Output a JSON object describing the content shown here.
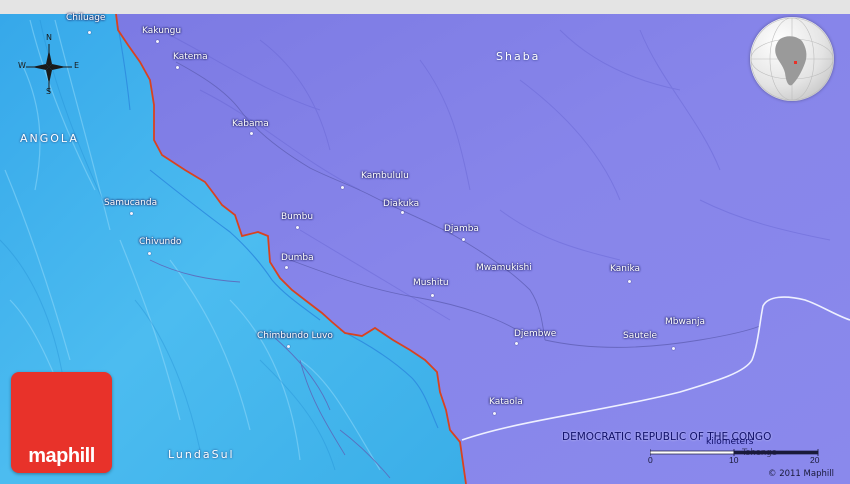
{
  "compass": {
    "n": "N",
    "s": "S",
    "e": "E",
    "w": "W"
  },
  "regions": {
    "angola": "ANGOLA",
    "shaba": "Shaba",
    "lunda_sul": "LundaSul"
  },
  "country_label": "DEMOCRATIC REPUBLIC OF THE CONGO",
  "places": {
    "chiluage": "Chiluage",
    "kakungu": "Kakungu",
    "katema": "Katema",
    "kabama": "Kabama",
    "kambululu": "Kambululu",
    "diakuka": "Diakuka",
    "bumbu": "Bumbu",
    "djamba": "Djamba",
    "dumba": "Dumba",
    "mwamukishi": "Mwamukishi",
    "kanika": "Kanika",
    "mushitu": "Mushitu",
    "samucanda": "Samucanda",
    "chivundo": "Chivundo",
    "chimbundo_luvo": "Chimbundo Luvo",
    "djembwe": "Djembwe",
    "sautele": "Sautele",
    "mbwanja": "Mbwanja",
    "kataola": "Kataola",
    "tshenge": "Tshenge"
  },
  "scale": {
    "unit": "kilometers",
    "tick0": "0",
    "tick1": "10",
    "tick2": "20"
  },
  "copyright": "© 2011 Maphill",
  "logo_text": "maphill",
  "colors": {
    "drc": "#7f7fe6",
    "angola": "#3fb0ea",
    "border": "#d9421f",
    "river": "#2f8fe0",
    "logo": "#e8322a"
  }
}
